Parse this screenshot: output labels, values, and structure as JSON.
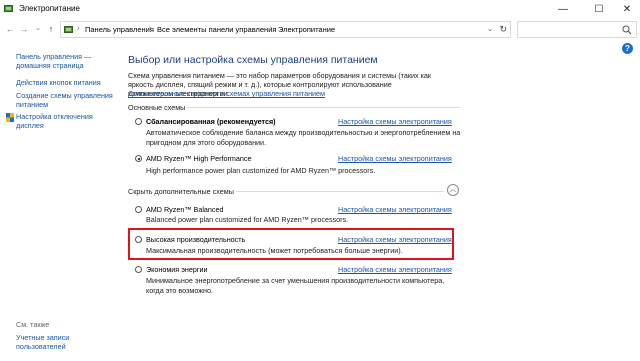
{
  "window": {
    "title": "Электропитание",
    "minimize": "—",
    "maximize": "☐",
    "close": "✕"
  },
  "address": {
    "crumbs": [
      "Панель управления",
      "Все элементы панели управления",
      "Электропитание"
    ],
    "separator": "›",
    "search_placeholder": ""
  },
  "sidebar": {
    "items": [
      {
        "label": "Панель управления —\nдомашняя страница"
      },
      {
        "label": "Действия кнопок питания"
      },
      {
        "label": "Создание схемы управления\nпитанием"
      },
      {
        "label": "Настройка отключения\nдисплея"
      }
    ],
    "see_also": "См. также",
    "bottom_link": "Учетные записи\nпользователей"
  },
  "main": {
    "title": "Выбор или настройка схемы управления питанием",
    "intro": "Схема управления питанием — это набор параметров оборудования и системы (таких как яркость дисплея, спящий режим и т. д.), которые контролируют использование компьютером электроэнергии.",
    "intro_link": "Дополнительные сведения о схемах управления питанием",
    "primary_group": "Основные схемы",
    "hidden_group": "Скрыть дополнительные схемы",
    "plan_link_label": "Настройка схемы электропитания",
    "plans": [
      {
        "name": "Сбалансированная (рекомендуется)",
        "bold": true,
        "selected": false,
        "desc": "Автоматическое соблюдение баланса между производительностью и энергопотреблением на пригодном для этого оборудовании."
      },
      {
        "name": "AMD Ryzen™ High Performance",
        "bold": false,
        "selected": true,
        "desc": "High performance power plan customized for AMD Ryzen™ processors."
      },
      {
        "name": "AMD Ryzen™ Balanced",
        "bold": false,
        "selected": false,
        "desc": "Balanced power plan customized for AMD Ryzen™ processors."
      },
      {
        "name": "Высокая производительность",
        "bold": false,
        "selected": false,
        "desc": "Максимальная производительность (может потребоваться больше энергии)."
      },
      {
        "name": "Экономия энергии",
        "bold": false,
        "selected": false,
        "desc": "Минимальное энергопотребление за счет уменьшения производительности компьютера, когда это возможно."
      }
    ]
  },
  "colors": {
    "link": "#1a55a8",
    "title": "#1e3e8a",
    "highlight": "#e0131a"
  }
}
